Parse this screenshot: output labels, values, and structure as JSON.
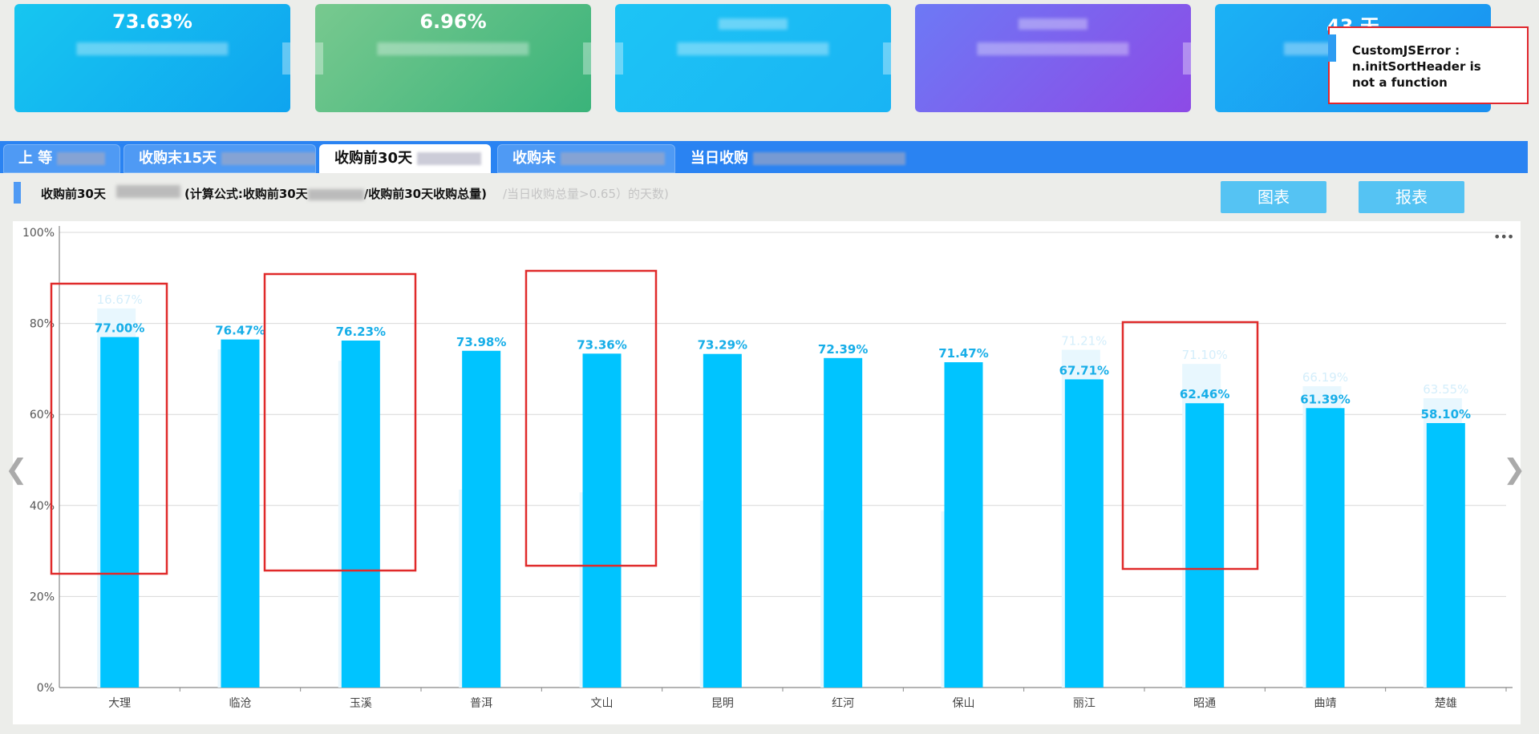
{
  "cards": [
    {
      "value": "73.63%"
    },
    {
      "value": "6.96%"
    },
    {
      "value": ""
    },
    {
      "value": ""
    },
    {
      "value": "43 天"
    }
  ],
  "error_popup": {
    "text_line1": "CustomJSError :",
    "text_line2": "n.initSortHeader is",
    "text_line3": "not a function"
  },
  "tabs": [
    {
      "label": "上 等"
    },
    {
      "label": "收购末15天"
    },
    {
      "label": "收购前30天"
    },
    {
      "label": "收购未"
    },
    {
      "label": "当日收购"
    }
  ],
  "section": {
    "title_prefix": "收购前30天",
    "formula": "(计算公式:收购前30天",
    "formula_tail": "/收购前30天收购总量)",
    "faded_note": "/当日收购总量>0.65）的天数)"
  },
  "buttons": {
    "chart": "图表",
    "report": "报表"
  },
  "colors": {
    "bar": "#00c4ff",
    "bar_label": "#17aee8",
    "ghost_bar": "#e8f7fe",
    "ghost_label": "#d4eefb",
    "annotation": "#e02a2a"
  },
  "chart_data": {
    "type": "bar",
    "categories": [
      "大理",
      "临沧",
      "玉溪",
      "普洱",
      "文山",
      "昆明",
      "红河",
      "保山",
      "丽江",
      "昭通",
      "曲靖",
      "楚雄"
    ],
    "values": [
      77.0,
      76.47,
      76.23,
      73.98,
      73.36,
      73.29,
      72.39,
      71.47,
      67.71,
      62.46,
      61.39,
      58.1
    ],
    "value_labels": [
      "77.00%",
      "76.47%",
      "76.23%",
      "73.98%",
      "73.36%",
      "73.29%",
      "72.39%",
      "71.47%",
      "67.71%",
      "62.46%",
      "61.39%",
      "58.10%"
    ],
    "ghost_values": [
      83.3,
      74.3,
      71.8,
      43.5,
      42.9,
      41.1,
      39.0,
      38.7,
      74.2,
      71.1,
      66.19,
      63.55
    ],
    "ghost_labels": [
      "16.67%",
      "",
      "",
      "",
      "",
      "",
      "",
      "",
      "71.21%",
      "71.10%",
      "66.19%",
      "63.55%"
    ],
    "yticks": [
      "0%",
      "20%",
      "40%",
      "60%",
      "80%",
      "100%"
    ],
    "ylim": [
      0,
      100
    ],
    "grid": true,
    "highlighted_categories": [
      "大理",
      "玉溪",
      "文山",
      "昭通"
    ]
  }
}
